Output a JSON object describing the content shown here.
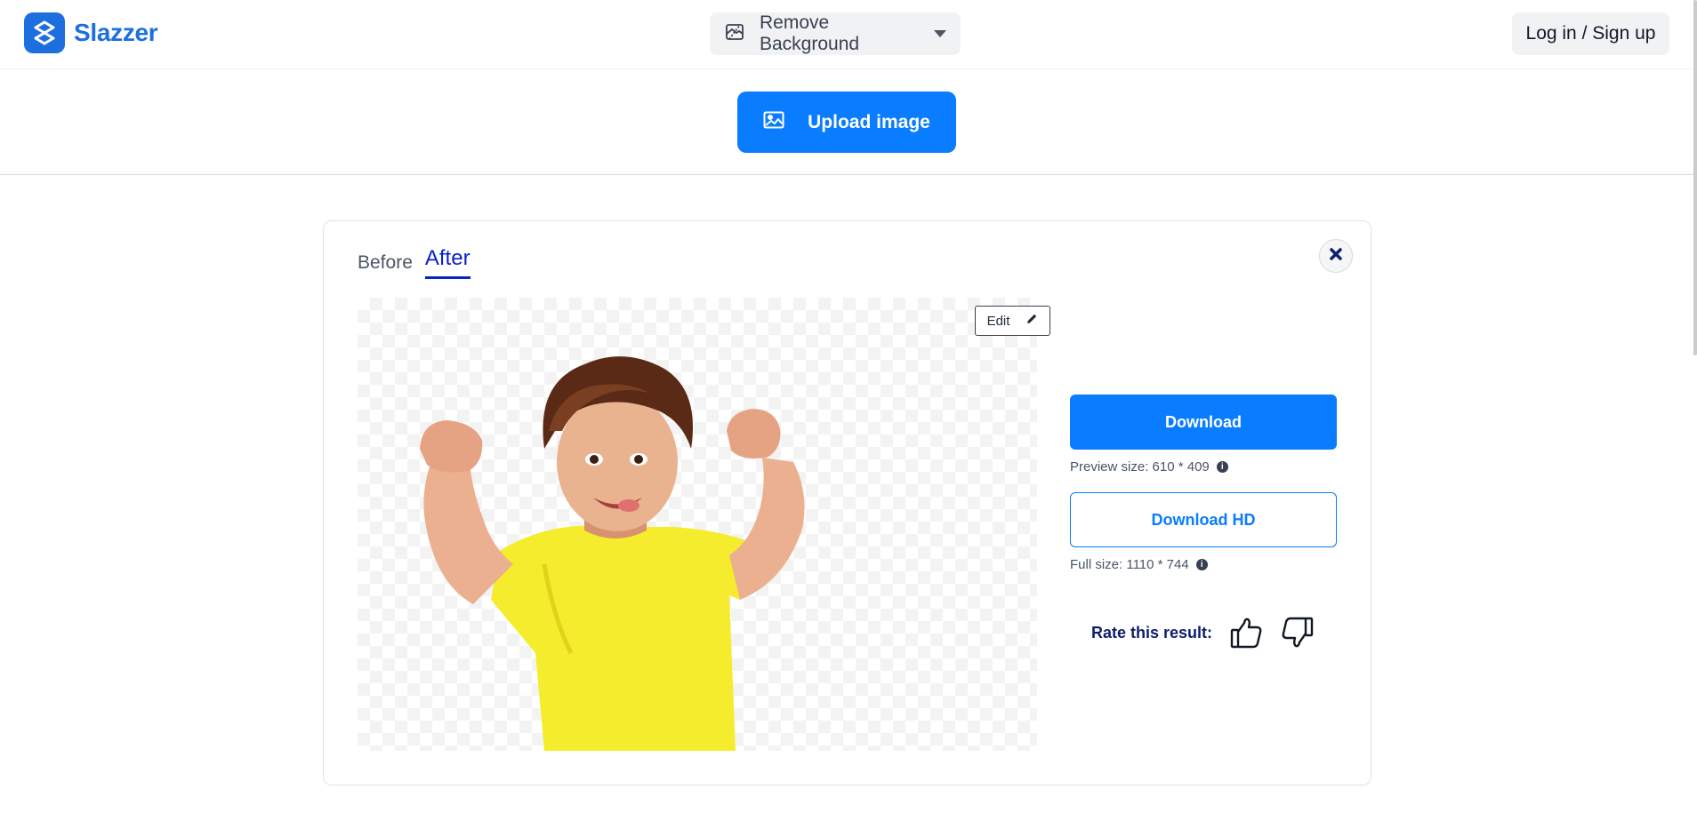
{
  "brand": {
    "name": "Slazzer",
    "color": "#1d6fe0",
    "icon": "slazzer-logo-icon"
  },
  "header": {
    "tool_select": {
      "label": "Remove Background",
      "icon": "remove-bg-icon"
    },
    "login_label": "Log in / Sign up"
  },
  "upload": {
    "label": "Upload image",
    "icon": "image-icon",
    "color": "#0a7cff"
  },
  "result": {
    "tabs": [
      {
        "label": "Before",
        "active": false
      },
      {
        "label": "After",
        "active": true
      }
    ],
    "edit_label": "Edit",
    "download_label": "Download",
    "preview_size": "Preview size: 610 * 409",
    "download_hd_label": "Download HD",
    "full_size": "Full size: 1110 * 744",
    "rate_label": "Rate this result:"
  }
}
